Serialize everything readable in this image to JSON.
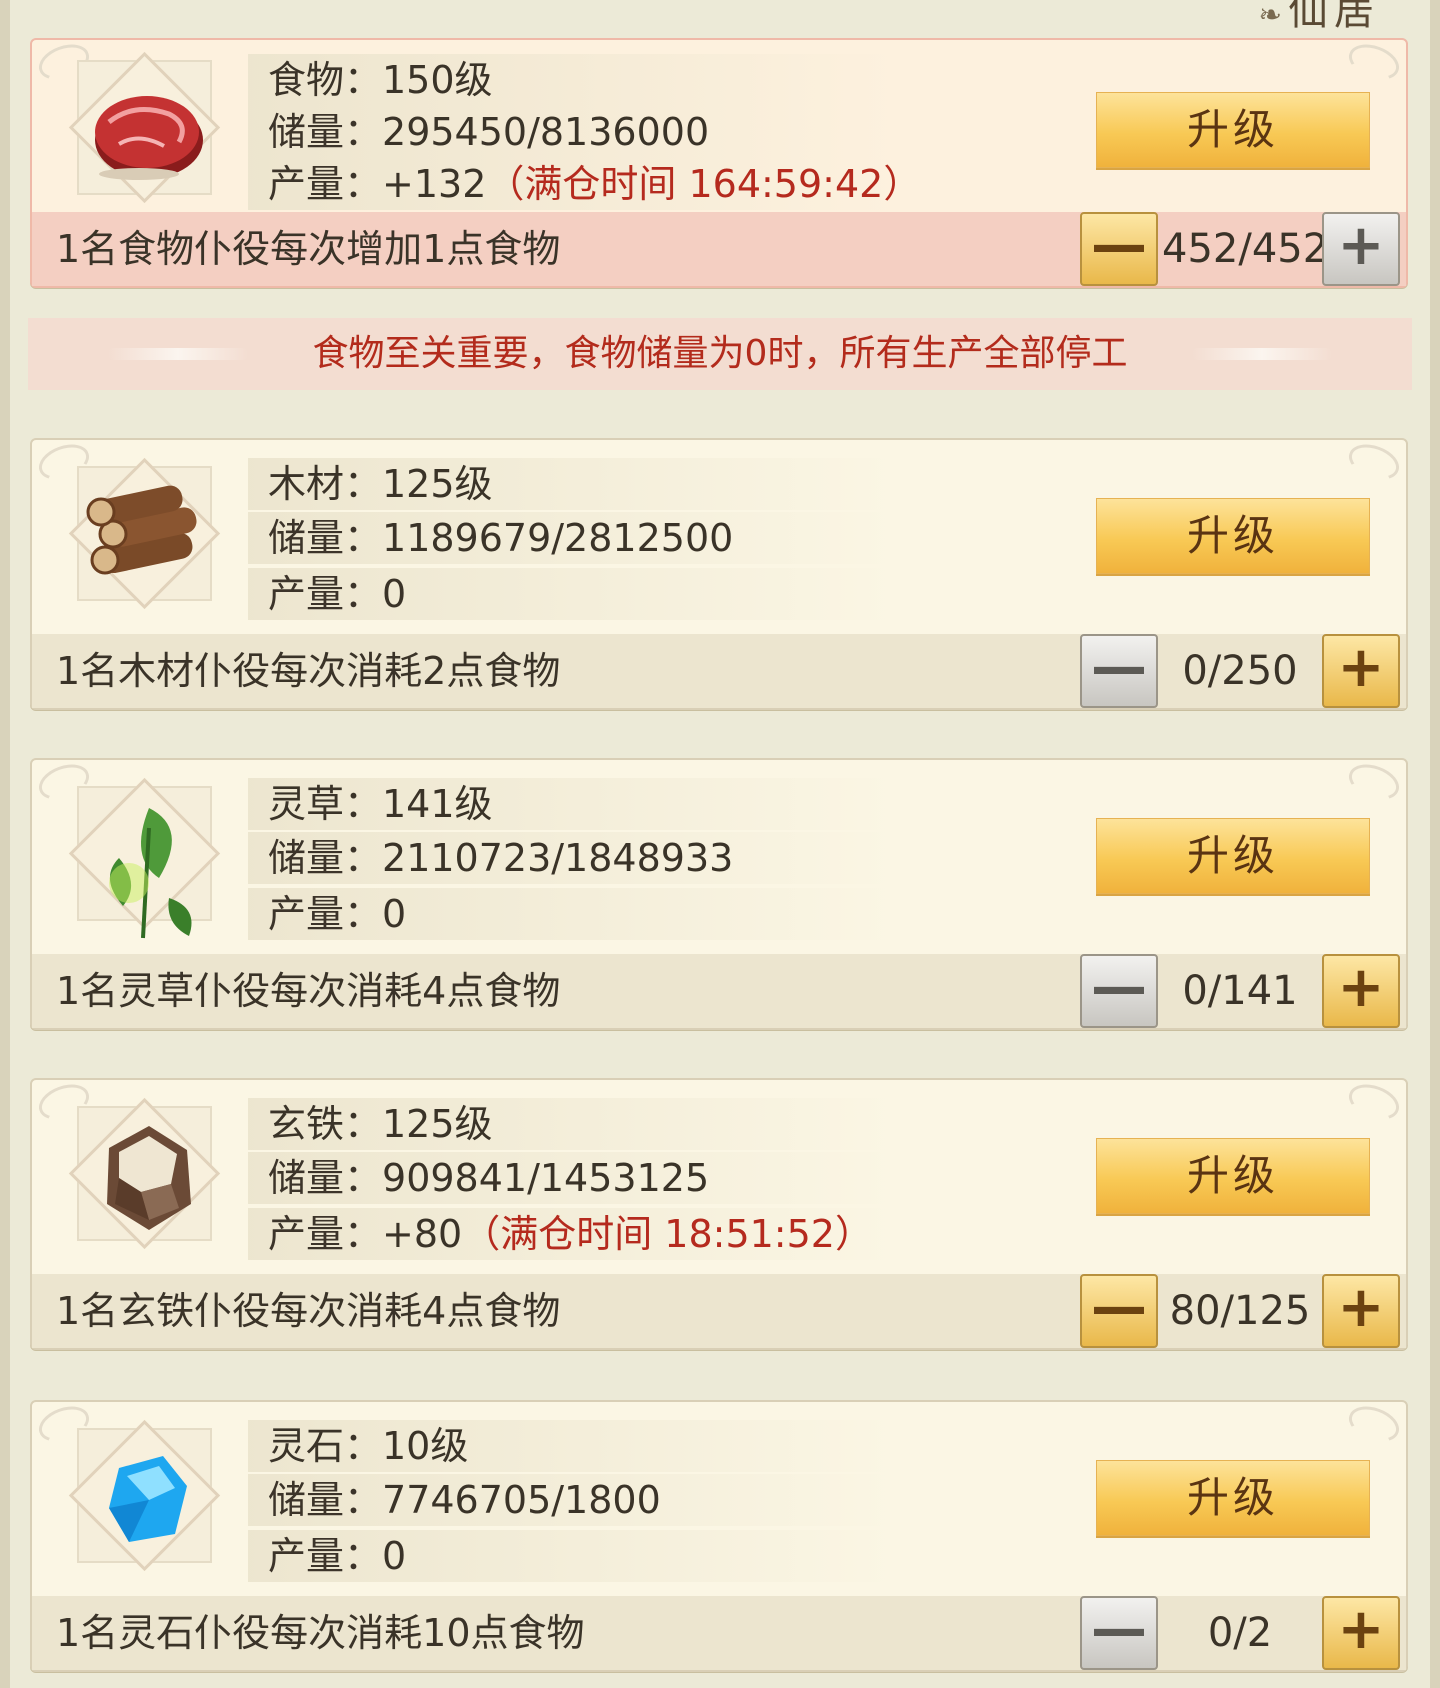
{
  "header": {
    "title_fragment": "仙居"
  },
  "resources": [
    {
      "id": "food",
      "icon": "meat-icon",
      "name_line": "食物：150级",
      "storage_label": "储量：",
      "storage_value": "295450/8136000",
      "output_label": "产量：",
      "output_value": "+132",
      "full_time": "（满仓时间 164:59:42）",
      "upgrade_label": "升级",
      "worker_text": "1名食物仆役每次增加1点食物",
      "worker_count": "452/452",
      "minus_active": true,
      "plus_active": false
    },
    {
      "id": "wood",
      "icon": "logs-icon",
      "name_line": "木材：125级",
      "storage_label": "储量：",
      "storage_value": "1189679/2812500",
      "output_label": "产量：",
      "output_value": "0",
      "full_time": "",
      "upgrade_label": "升级",
      "worker_text": "1名木材仆役每次消耗2点食物",
      "worker_count": "0/250",
      "minus_active": false,
      "plus_active": true
    },
    {
      "id": "herb",
      "icon": "herb-leaf-icon",
      "name_line": "灵草：141级",
      "storage_label": "储量：",
      "storage_value": "2110723/1848933",
      "output_label": "产量：",
      "output_value": "0",
      "full_time": "",
      "upgrade_label": "升级",
      "worker_text": "1名灵草仆役每次消耗4点食物",
      "worker_count": "0/141",
      "minus_active": false,
      "plus_active": true
    },
    {
      "id": "iron",
      "icon": "ore-rock-icon",
      "name_line": "玄铁：125级",
      "storage_label": "储量：",
      "storage_value": "909841/1453125",
      "output_label": "产量：",
      "output_value": "+80",
      "full_time": "（满仓时间 18:51:52）",
      "upgrade_label": "升级",
      "worker_text": "1名玄铁仆役每次消耗4点食物",
      "worker_count": "80/125",
      "minus_active": true,
      "plus_active": true
    },
    {
      "id": "stone",
      "icon": "blue-crystal-icon",
      "name_line": "灵石：10级",
      "storage_label": "储量：",
      "storage_value": "7746705/1800",
      "output_label": "产量：",
      "output_value": "0",
      "full_time": "",
      "upgrade_label": "升级",
      "worker_text": "1名灵石仆役每次消耗10点食物",
      "worker_count": "0/2",
      "minus_active": false,
      "plus_active": true
    }
  ],
  "warning": "食物至关重要，食物储量为0时，所有生产全部停工",
  "controls": {
    "minus_symbol": "—",
    "plus_symbol": "+"
  }
}
